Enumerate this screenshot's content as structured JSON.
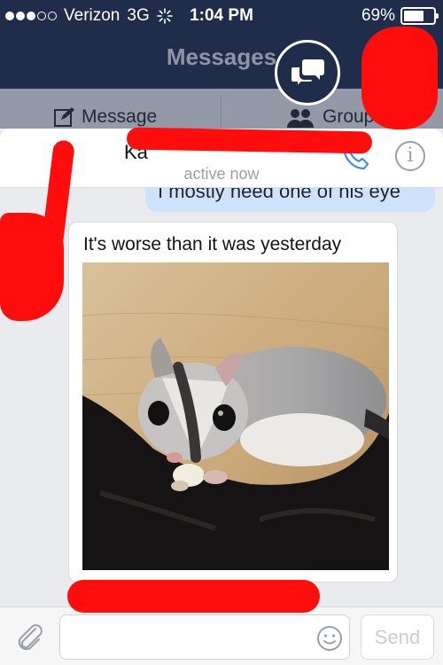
{
  "status_bar": {
    "carrier": "Verizon",
    "network": "3G",
    "time": "1:04 PM",
    "battery_percent": "69%",
    "battery_level": 0.69,
    "signal_bars_filled": 3,
    "signal_bars_total": 5
  },
  "nav": {
    "title": "Messages",
    "compose_icon": "chat-bubbles-icon"
  },
  "segments": {
    "message_label": "Message",
    "message_icon": "compose-icon",
    "group_label": "Group",
    "group_icon": "people-icon"
  },
  "thread": {
    "contact_name_visible": "Ka",
    "status": "active now"
  },
  "messages": {
    "sent": "I mostly need one of his eye",
    "received_text": "It's worse than it was yesterday",
    "received_photo": "photo of a sugar glider on a black blanket"
  },
  "composer": {
    "placeholder": "",
    "send_label": "Send"
  },
  "colors": {
    "nav_bg": "#1f2d4b",
    "sent_bubble": "#cfe2fb",
    "redaction": "#ff0d0d",
    "accent": "#3b8fe8"
  }
}
